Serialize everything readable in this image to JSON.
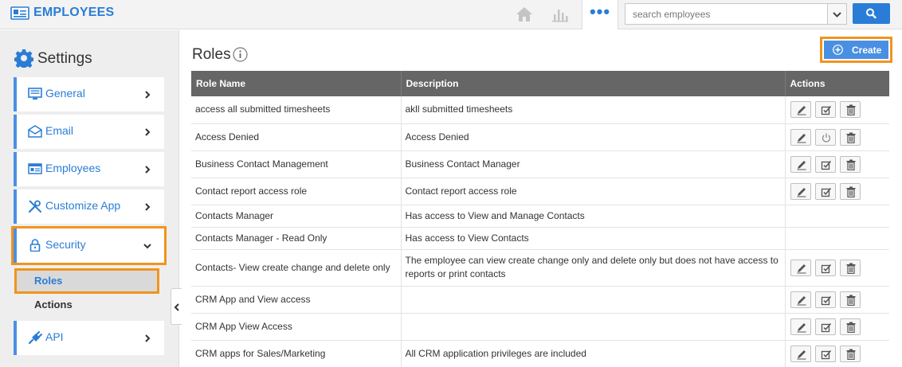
{
  "header": {
    "app_title": "EMPLOYEES",
    "more_label": "•••",
    "search_placeholder": "search employees"
  },
  "sidebar": {
    "title": "Settings",
    "items": [
      {
        "label": "General",
        "icon": "monitor-icon"
      },
      {
        "label": "Email",
        "icon": "envelope-icon"
      },
      {
        "label": "Employees",
        "icon": "id-card-icon"
      },
      {
        "label": "Customize App",
        "icon": "tools-icon"
      },
      {
        "label": "Security",
        "icon": "lock-icon",
        "expanded": true
      },
      {
        "label": "API",
        "icon": "plug-icon"
      }
    ],
    "security_subitems": [
      {
        "label": "Roles",
        "selected": true
      },
      {
        "label": "Actions",
        "selected": false
      }
    ]
  },
  "main": {
    "title": "Roles",
    "create_label": "Create",
    "columns": [
      "Role Name",
      "Description",
      "Actions"
    ],
    "rows": [
      {
        "name": "access all submitted timesheets",
        "description": "akll submitted timesheets",
        "actions": [
          "edit",
          "check",
          "delete"
        ]
      },
      {
        "name": "Access Denied",
        "description": "Access Denied",
        "actions": [
          "edit",
          "power",
          "delete"
        ]
      },
      {
        "name": "Business Contact Management",
        "description": "Business Contact Manager",
        "actions": [
          "edit",
          "check",
          "delete"
        ]
      },
      {
        "name": "Contact report access role",
        "description": "Contact report access role",
        "actions": [
          "edit",
          "check",
          "delete"
        ]
      },
      {
        "name": "Contacts Manager",
        "description": "Has access to View and Manage Contacts",
        "actions": []
      },
      {
        "name": "Contacts Manager - Read Only",
        "description": "Has access to View Contacts",
        "actions": []
      },
      {
        "name": "Contacts- View create change and delete only",
        "description": "The employee can view create change only and delete only but does not have access to reports or print contacts",
        "actions": [
          "edit",
          "check",
          "delete"
        ]
      },
      {
        "name": "CRM App and View access",
        "description": "",
        "actions": [
          "edit",
          "check",
          "delete"
        ]
      },
      {
        "name": "CRM App View Access",
        "description": "",
        "actions": [
          "edit",
          "check",
          "delete"
        ]
      },
      {
        "name": "CRM apps for Sales/Marketing",
        "description": "All CRM application privileges are included",
        "actions": [
          "edit",
          "check",
          "delete"
        ]
      }
    ]
  },
  "colors": {
    "accent": "#2a7dd6",
    "highlight": "#f0941d",
    "header_row": "#666666"
  }
}
